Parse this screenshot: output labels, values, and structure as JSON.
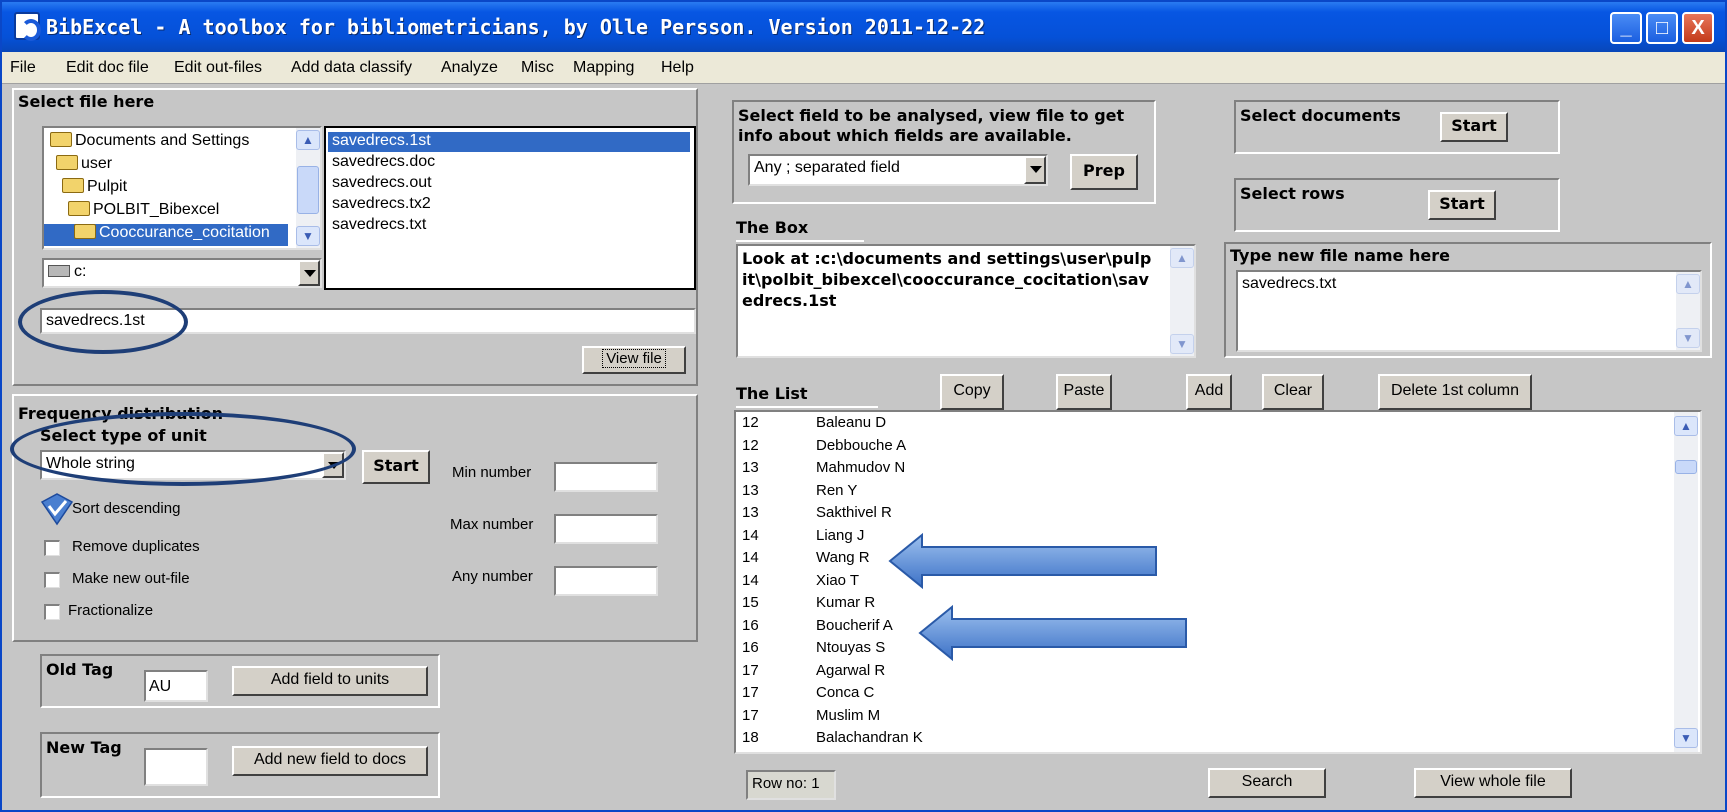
{
  "window": {
    "title": "BibExcel -  A toolbox for bibliometricians, by Olle Persson. Version 2011-12-22",
    "controls": [
      "_",
      "□",
      "X"
    ]
  },
  "menu": [
    "File",
    "Edit doc file",
    "Edit out-files",
    "Add data classify",
    "Analyze",
    "Misc",
    "Mapping",
    "Help"
  ],
  "select_file": {
    "heading": "Select file here",
    "folders": [
      "Documents and Settings",
      "user",
      "Pulpit",
      "POLBIT_Bibexcel",
      "Cooccurance_cocitation"
    ],
    "files": [
      "savedrecs.1st",
      "savedrecs.doc",
      "savedrecs.out",
      "savedrecs.tx2",
      "savedrecs.txt"
    ],
    "drive": "c:",
    "filename": "savedrecs.1st",
    "view_file": "View file"
  },
  "freq": {
    "heading": "Frequency distribution",
    "unit_label": "Select type of unit",
    "unit_value": "Whole string",
    "start": "Start",
    "sort_descending": "Sort descending",
    "remove_duplicates": "Remove duplicates",
    "make_new_outfile": "Make new out-file",
    "fractionalize": "Fractionalize",
    "min_number": "Min number",
    "max_number": "Max number",
    "any_number": "Any number"
  },
  "old_tag": {
    "label": "Old Tag",
    "value": "AU",
    "button": "Add field to units"
  },
  "new_tag": {
    "label": "New Tag",
    "value": "",
    "button": "Add new field to docs"
  },
  "field_select": {
    "text": "Select field to be analysed, view file to get info about which fields are available.",
    "value": "Any ; separated field",
    "prep": "Prep"
  },
  "select_documents": {
    "label": "Select documents",
    "button": "Start"
  },
  "select_rows": {
    "label": "Select rows",
    "button": "Start"
  },
  "the_box": {
    "label": "The Box",
    "text": "Look at :c:\\documents and settings\\user\\pulpit\\polbit_bibexcel\\cooccurance_cocitation\\savedrecs.1st"
  },
  "new_file": {
    "label": "Type new file name here",
    "value": "savedrecs.txt"
  },
  "the_list": {
    "label": "The List",
    "buttons": {
      "copy": "Copy",
      "paste": "Paste",
      "add": "Add",
      "clear": "Clear",
      "delete_first": "Delete 1st column"
    },
    "rows": [
      {
        "n": "12",
        "name": "Baleanu D"
      },
      {
        "n": "12",
        "name": "Debbouche A"
      },
      {
        "n": "13",
        "name": "Mahmudov N"
      },
      {
        "n": "13",
        "name": "Ren Y"
      },
      {
        "n": "13",
        "name": "Sakthivel R"
      },
      {
        "n": "14",
        "name": "Liang J"
      },
      {
        "n": "14",
        "name": "Wang R"
      },
      {
        "n": "14",
        "name": "Xiao T"
      },
      {
        "n": "15",
        "name": "Kumar R"
      },
      {
        "n": "16",
        "name": "Boucherif A"
      },
      {
        "n": "16",
        "name": "Ntouyas S"
      },
      {
        "n": "17",
        "name": "Agarwal R"
      },
      {
        "n": "17",
        "name": "Conca C"
      },
      {
        "n": "17",
        "name": "Muslim M"
      },
      {
        "n": "18",
        "name": "Balachandran K"
      }
    ]
  },
  "bottom": {
    "row_no": "Row no: 1",
    "search": "Search",
    "view_whole": "View whole file"
  },
  "colors": {
    "titlebar": "#0551d8",
    "selection": "#316ac5",
    "annotation": "#1e3e77",
    "arrow": "#5b8fd6"
  }
}
